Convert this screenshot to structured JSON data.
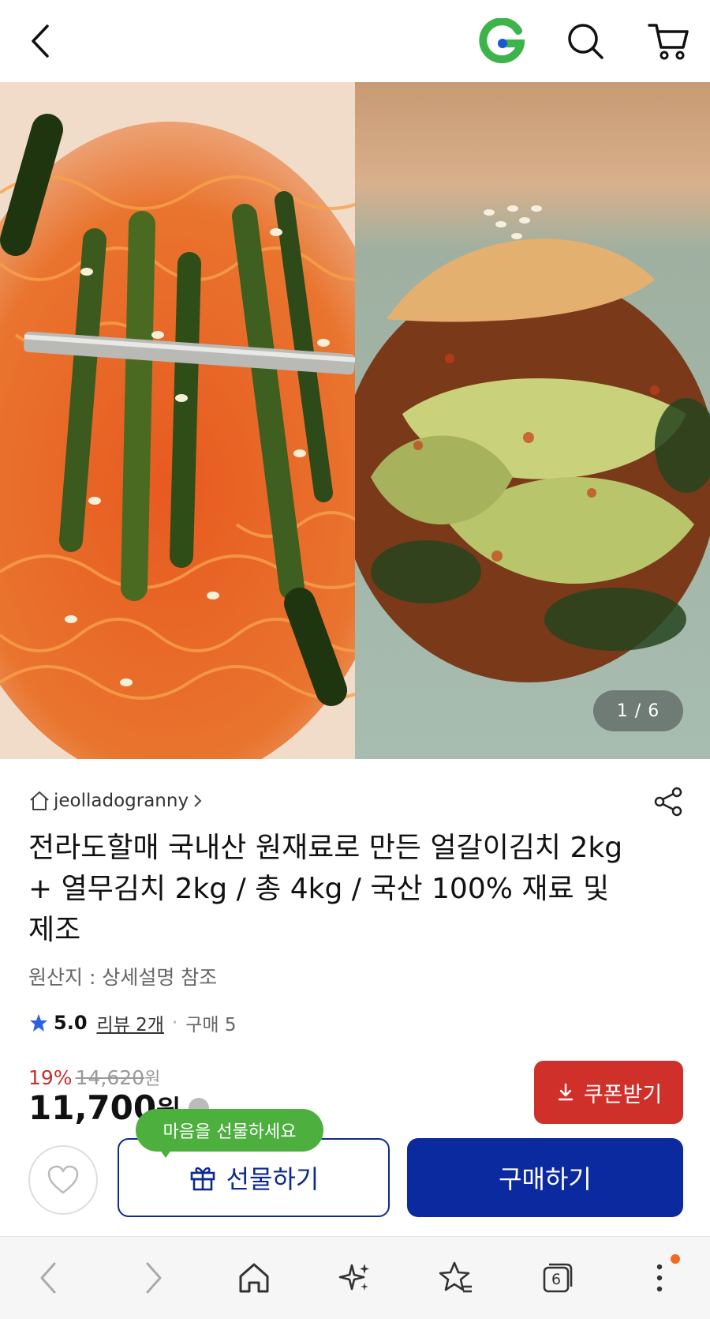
{
  "header": {
    "back_icon": "chevron-left-icon",
    "logo_letter": "G",
    "logo_color": "#3cb44b",
    "search_icon": "search-icon",
    "cart_icon": "cart-icon"
  },
  "gallery": {
    "counter": "1 / 6",
    "images": [
      "spicy-noodles-with-young-radish-kimchi",
      "cabbage-kimchi"
    ]
  },
  "product": {
    "seller": "jeolladogranny",
    "title": "전라도할매 국내산 원재료로 만든 얼갈이김치 2kg + 열무김치 2kg / 총 4kg / 국산 100% 재료 및 제조",
    "origin": "원산지 : 상세설명 참조",
    "rating": "5.0",
    "review_link": "리뷰 2개",
    "purchase_count": "구매 5",
    "discount_percent": "19%",
    "original_price": "14,620",
    "original_unit": "원",
    "price": "11,700",
    "price_unit": "원"
  },
  "buttons": {
    "coupon": "쿠폰받기",
    "gift_tooltip": "마음을 선물하세요",
    "gift": "선물하기",
    "buy": "구매하기"
  },
  "browser": {
    "tab_count": "6",
    "notification_color": "#f26b21"
  },
  "colors": {
    "accent_blue": "#0c2a9f",
    "coupon_red": "#d0302a",
    "tooltip_green": "#4caf3e",
    "discount_red": "#c9302c"
  }
}
